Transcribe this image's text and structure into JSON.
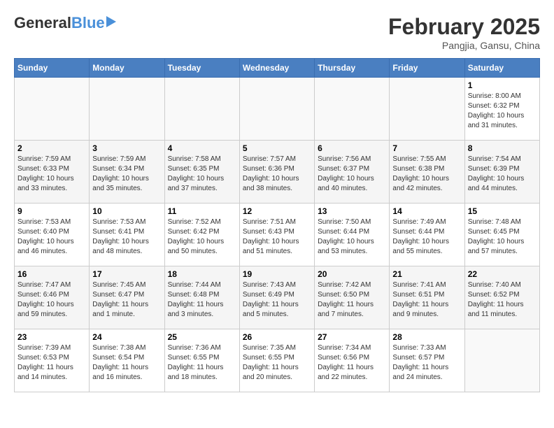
{
  "header": {
    "logo_general": "General",
    "logo_blue": "Blue",
    "month_year": "February 2025",
    "location": "Pangjia, Gansu, China"
  },
  "weekdays": [
    "Sunday",
    "Monday",
    "Tuesday",
    "Wednesday",
    "Thursday",
    "Friday",
    "Saturday"
  ],
  "weeks": [
    [
      {
        "day": "",
        "info": ""
      },
      {
        "day": "",
        "info": ""
      },
      {
        "day": "",
        "info": ""
      },
      {
        "day": "",
        "info": ""
      },
      {
        "day": "",
        "info": ""
      },
      {
        "day": "",
        "info": ""
      },
      {
        "day": "1",
        "info": "Sunrise: 8:00 AM\nSunset: 6:32 PM\nDaylight: 10 hours\nand 31 minutes."
      }
    ],
    [
      {
        "day": "2",
        "info": "Sunrise: 7:59 AM\nSunset: 6:33 PM\nDaylight: 10 hours\nand 33 minutes."
      },
      {
        "day": "3",
        "info": "Sunrise: 7:59 AM\nSunset: 6:34 PM\nDaylight: 10 hours\nand 35 minutes."
      },
      {
        "day": "4",
        "info": "Sunrise: 7:58 AM\nSunset: 6:35 PM\nDaylight: 10 hours\nand 37 minutes."
      },
      {
        "day": "5",
        "info": "Sunrise: 7:57 AM\nSunset: 6:36 PM\nDaylight: 10 hours\nand 38 minutes."
      },
      {
        "day": "6",
        "info": "Sunrise: 7:56 AM\nSunset: 6:37 PM\nDaylight: 10 hours\nand 40 minutes."
      },
      {
        "day": "7",
        "info": "Sunrise: 7:55 AM\nSunset: 6:38 PM\nDaylight: 10 hours\nand 42 minutes."
      },
      {
        "day": "8",
        "info": "Sunrise: 7:54 AM\nSunset: 6:39 PM\nDaylight: 10 hours\nand 44 minutes."
      }
    ],
    [
      {
        "day": "9",
        "info": "Sunrise: 7:53 AM\nSunset: 6:40 PM\nDaylight: 10 hours\nand 46 minutes."
      },
      {
        "day": "10",
        "info": "Sunrise: 7:53 AM\nSunset: 6:41 PM\nDaylight: 10 hours\nand 48 minutes."
      },
      {
        "day": "11",
        "info": "Sunrise: 7:52 AM\nSunset: 6:42 PM\nDaylight: 10 hours\nand 50 minutes."
      },
      {
        "day": "12",
        "info": "Sunrise: 7:51 AM\nSunset: 6:43 PM\nDaylight: 10 hours\nand 51 minutes."
      },
      {
        "day": "13",
        "info": "Sunrise: 7:50 AM\nSunset: 6:44 PM\nDaylight: 10 hours\nand 53 minutes."
      },
      {
        "day": "14",
        "info": "Sunrise: 7:49 AM\nSunset: 6:44 PM\nDaylight: 10 hours\nand 55 minutes."
      },
      {
        "day": "15",
        "info": "Sunrise: 7:48 AM\nSunset: 6:45 PM\nDaylight: 10 hours\nand 57 minutes."
      }
    ],
    [
      {
        "day": "16",
        "info": "Sunrise: 7:47 AM\nSunset: 6:46 PM\nDaylight: 10 hours\nand 59 minutes."
      },
      {
        "day": "17",
        "info": "Sunrise: 7:45 AM\nSunset: 6:47 PM\nDaylight: 11 hours\nand 1 minute."
      },
      {
        "day": "18",
        "info": "Sunrise: 7:44 AM\nSunset: 6:48 PM\nDaylight: 11 hours\nand 3 minutes."
      },
      {
        "day": "19",
        "info": "Sunrise: 7:43 AM\nSunset: 6:49 PM\nDaylight: 11 hours\nand 5 minutes."
      },
      {
        "day": "20",
        "info": "Sunrise: 7:42 AM\nSunset: 6:50 PM\nDaylight: 11 hours\nand 7 minutes."
      },
      {
        "day": "21",
        "info": "Sunrise: 7:41 AM\nSunset: 6:51 PM\nDaylight: 11 hours\nand 9 minutes."
      },
      {
        "day": "22",
        "info": "Sunrise: 7:40 AM\nSunset: 6:52 PM\nDaylight: 11 hours\nand 11 minutes."
      }
    ],
    [
      {
        "day": "23",
        "info": "Sunrise: 7:39 AM\nSunset: 6:53 PM\nDaylight: 11 hours\nand 14 minutes."
      },
      {
        "day": "24",
        "info": "Sunrise: 7:38 AM\nSunset: 6:54 PM\nDaylight: 11 hours\nand 16 minutes."
      },
      {
        "day": "25",
        "info": "Sunrise: 7:36 AM\nSunset: 6:55 PM\nDaylight: 11 hours\nand 18 minutes."
      },
      {
        "day": "26",
        "info": "Sunrise: 7:35 AM\nSunset: 6:55 PM\nDaylight: 11 hours\nand 20 minutes."
      },
      {
        "day": "27",
        "info": "Sunrise: 7:34 AM\nSunset: 6:56 PM\nDaylight: 11 hours\nand 22 minutes."
      },
      {
        "day": "28",
        "info": "Sunrise: 7:33 AM\nSunset: 6:57 PM\nDaylight: 11 hours\nand 24 minutes."
      },
      {
        "day": "",
        "info": ""
      }
    ]
  ]
}
